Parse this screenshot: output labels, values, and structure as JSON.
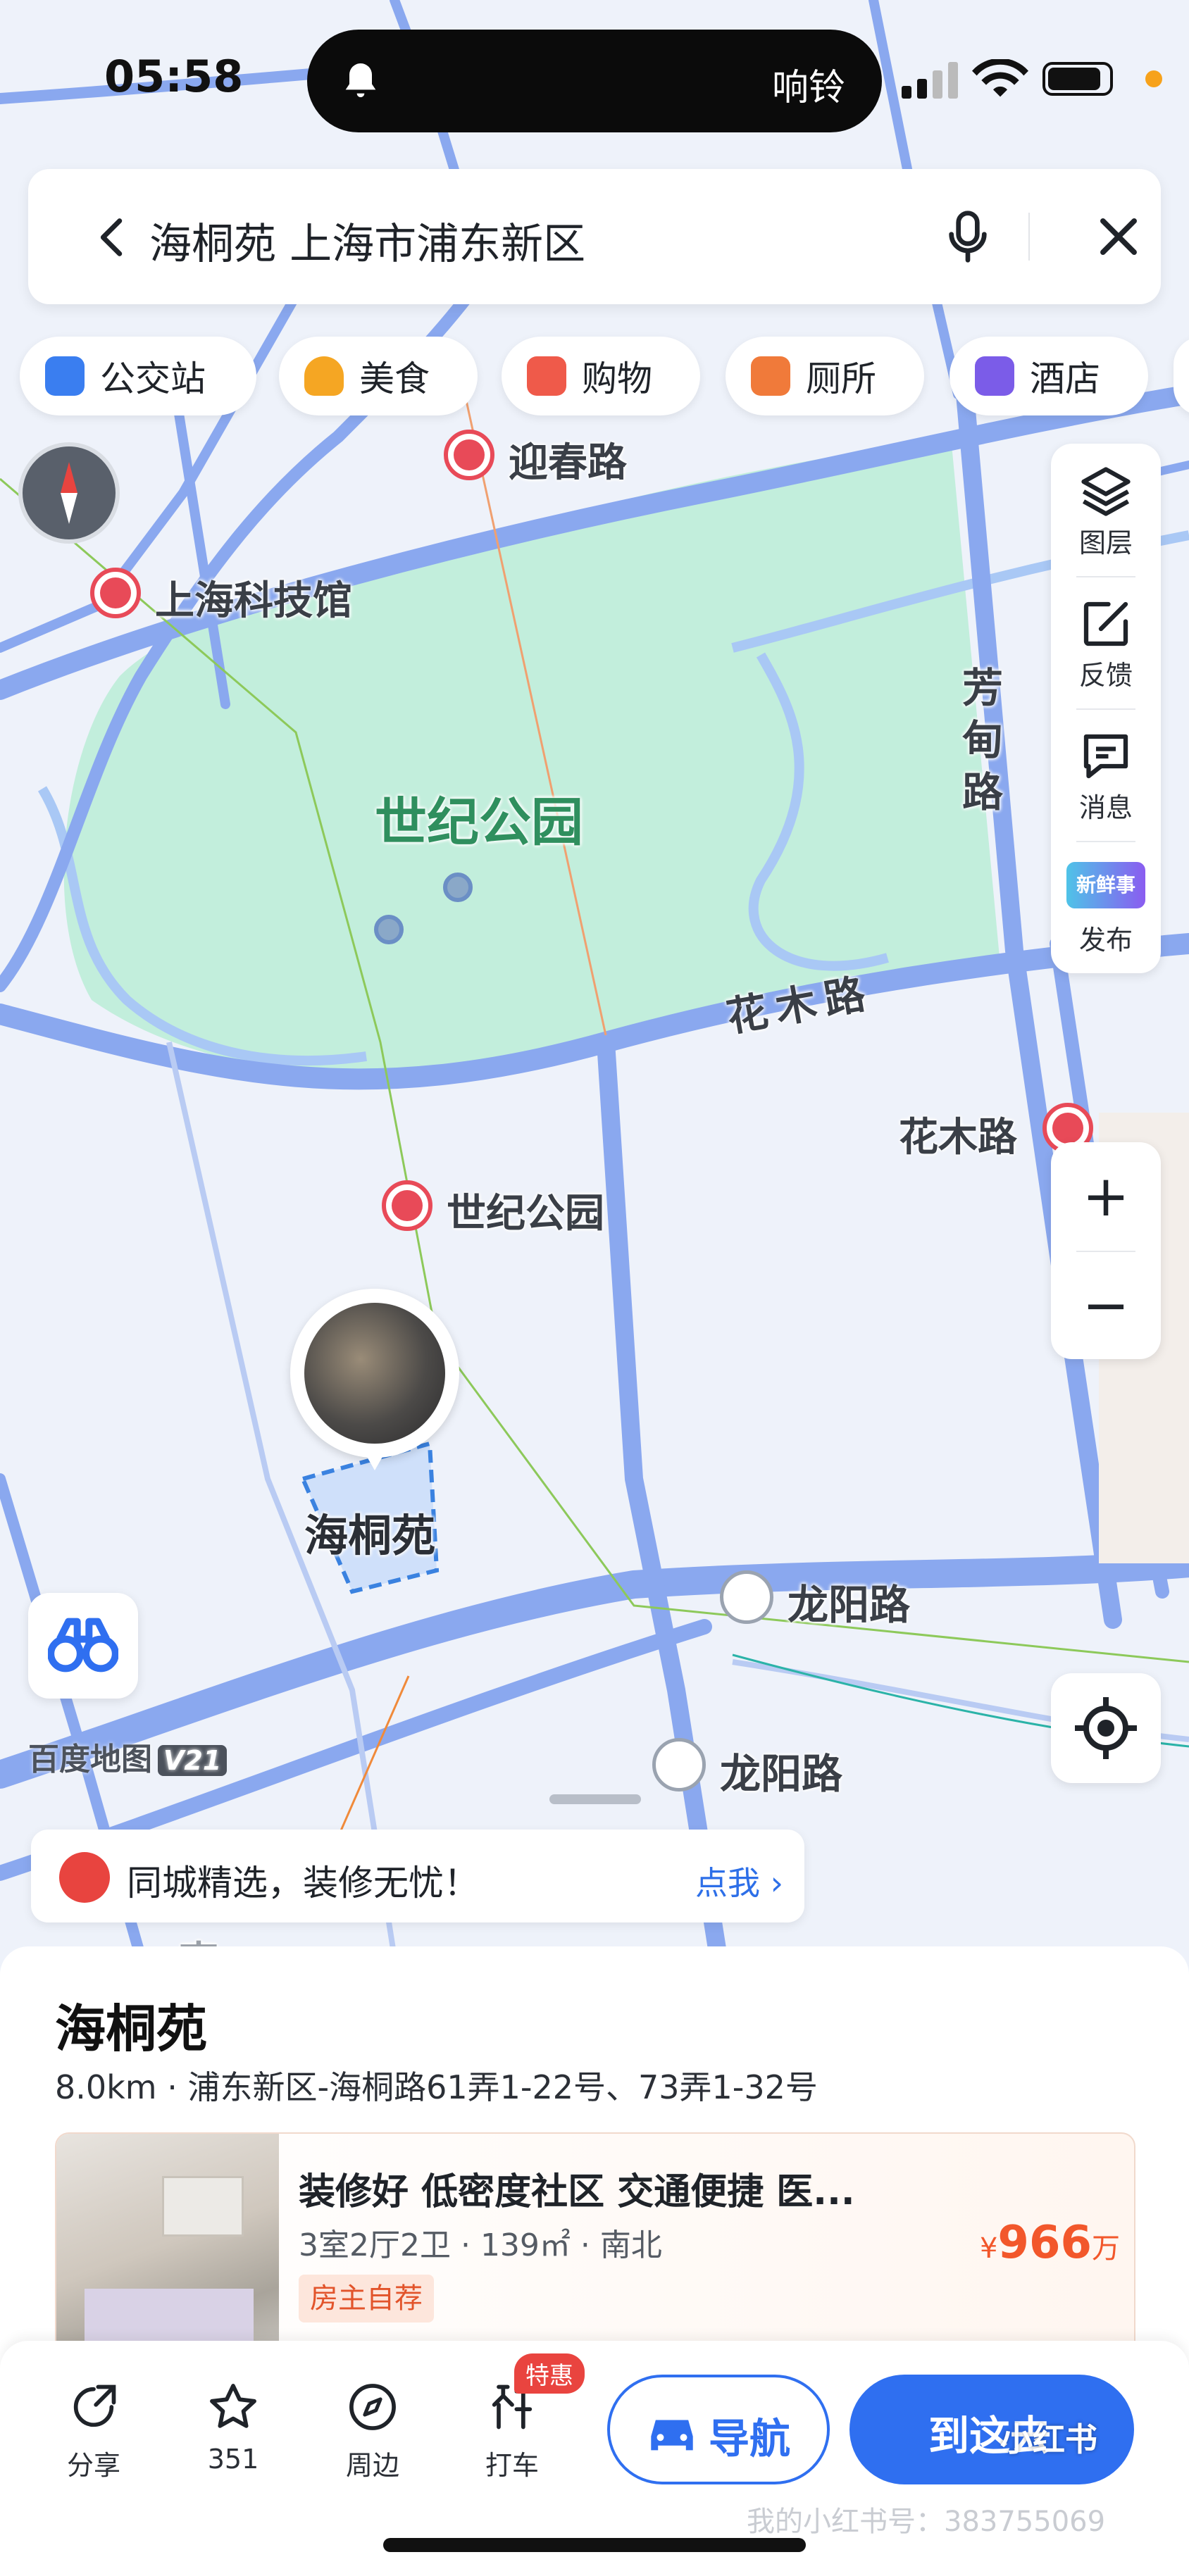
{
  "status_bar": {
    "time": "05:58",
    "notification_label": "响铃",
    "icons": [
      "bell-icon",
      "signal-icon",
      "wifi-icon",
      "battery-icon"
    ]
  },
  "search": {
    "query": "海桐苑 上海市浦东新区",
    "icons": [
      "back-arrow-icon",
      "microphone-icon",
      "close-icon"
    ]
  },
  "categories": [
    {
      "label": "公交站",
      "icon": "bus-stop-icon",
      "color": "#3a7ef0"
    },
    {
      "label": "美食",
      "icon": "food-icon",
      "color": "#f5a623"
    },
    {
      "label": "购物",
      "icon": "shopping-bag-icon",
      "color": "#ef5a4a"
    },
    {
      "label": "厕所",
      "icon": "restroom-icon",
      "color": "#f07a3a"
    },
    {
      "label": "酒店",
      "icon": "hotel-icon",
      "color": "#7b5ce8"
    }
  ],
  "right_toolbar": [
    {
      "label": "图层",
      "icon": "layers-icon"
    },
    {
      "label": "反馈",
      "icon": "feedback-icon"
    },
    {
      "label": "消息",
      "icon": "message-icon"
    },
    {
      "label": "发布",
      "icon": "news-publish-icon",
      "badge_text": "新鲜事"
    }
  ],
  "map": {
    "labels": {
      "park": "世纪公园",
      "fangdian_road": "芳甸路",
      "huamu_road": "花木路",
      "haitongyuan": "海桐苑",
      "longyang_road_1": "龙阳路",
      "longyang_road_2": "龙阳路",
      "south_partial": "南"
    },
    "metro_stations": {
      "yingchun": "迎春路",
      "science_museum": "上海科技馆",
      "huamu": "花木路",
      "century_park": "世纪公园"
    },
    "brand": "百度地图",
    "brand_version": "V21",
    "colors": {
      "road": "#8aa8ef",
      "park": "#c2eedc",
      "metro": "#e84a58",
      "background": "#eef2fa"
    }
  },
  "zoom": {
    "in": "+",
    "out": "−"
  },
  "promo": {
    "text": "同城精选，装修无忧！",
    "link": "点我",
    "link_arrow": "›"
  },
  "place": {
    "name": "海桐苑",
    "meta": "8.0km · 浦东新区-海桐路61弄1-22号、73弄1-32号"
  },
  "listing": {
    "title": "装修好 低密度社区 交通便捷 医...",
    "specs": "3室2厅2卫 · 139㎡ · 南北",
    "tag": "房主自荐",
    "price_currency": "¥",
    "price": "966",
    "price_unit": "万"
  },
  "actions": [
    {
      "label": "分享",
      "icon": "share-icon"
    },
    {
      "label": "351",
      "icon": "star-icon"
    },
    {
      "label": "周边",
      "icon": "compass-icon"
    },
    {
      "label": "打车",
      "icon": "taxi-icon"
    }
  ],
  "taxi_badge": "特惠",
  "nav_button": "导航",
  "go_button": "到这去",
  "watermark": {
    "logo": "小红书",
    "text": "我的小红书号：383755069"
  }
}
